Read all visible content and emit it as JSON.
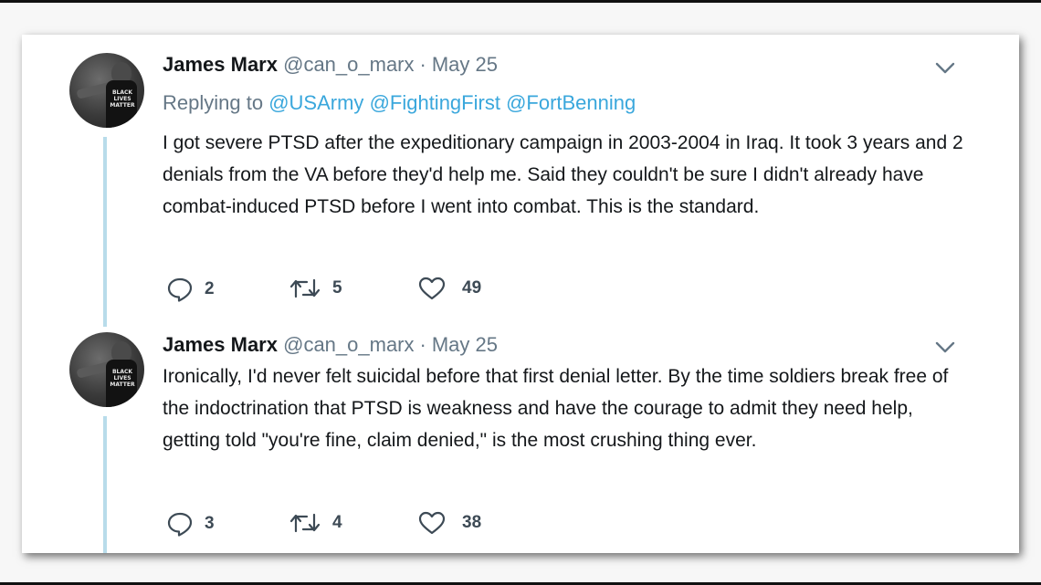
{
  "tweets": [
    {
      "author_name": "James Marx",
      "handle": "@can_o_marx",
      "separator": "·",
      "date": "May 25",
      "replying_prefix": "Replying to",
      "mentions": [
        "@USArmy",
        "@FightingFirst",
        "@FortBenning"
      ],
      "text": "I got severe PTSD after the expeditionary campaign in 2003-2004 in Iraq. It took 3 years and 2 denials from the VA before they'd help me. Said they couldn't be sure I didn't already have combat-induced PTSD before I went into combat. This is the standard.",
      "avatar_text": "BLACK LIVES MATTER",
      "reply_count": "2",
      "retweet_count": "5",
      "like_count": "49"
    },
    {
      "author_name": "James Marx",
      "handle": "@can_o_marx",
      "separator": "·",
      "date": "May 25",
      "text": "Ironically, I'd never felt suicidal before that first denial letter. By the time soldiers break free of the indoctrination that PTSD is weakness and have the courage to admit they need help, getting told \"you're fine, claim denied,\" is the most crushing thing ever.",
      "avatar_text": "BLACK LIVES MATTER",
      "reply_count": "3",
      "retweet_count": "4",
      "like_count": "38"
    }
  ],
  "colors": {
    "mention": "#3aa7dc",
    "thread_line": "#b8dcea",
    "text": "#14171a",
    "muted": "#657786"
  },
  "icons": [
    "chevron-down-icon",
    "reply-icon",
    "retweet-icon",
    "like-icon"
  ]
}
